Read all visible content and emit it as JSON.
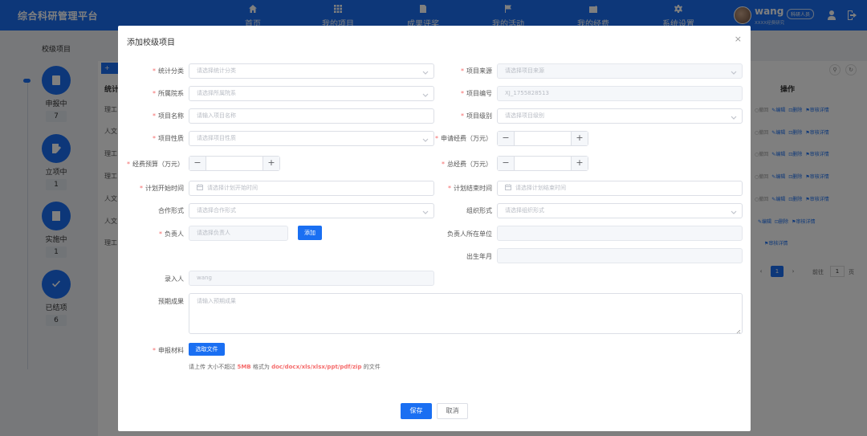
{
  "app": {
    "title": "综合科研管理平台"
  },
  "nav": [
    {
      "label": "首页",
      "icon": "home-icon"
    },
    {
      "label": "我的项目",
      "icon": "grid-icon"
    },
    {
      "label": "成果评奖",
      "icon": "document-icon"
    },
    {
      "label": "我的活动",
      "icon": "flag-icon"
    },
    {
      "label": "我的经费",
      "icon": "wallet-icon"
    },
    {
      "label": "系统设置",
      "icon": "gear-icon"
    }
  ],
  "user": {
    "name": "wang",
    "role": "科研人员",
    "org": "XXXX经费研究"
  },
  "sidebar": {
    "title": "校级项目",
    "statuses": [
      {
        "label": "申报中",
        "count": "7"
      },
      {
        "label": "立项中",
        "count": "1"
      },
      {
        "label": "实施中",
        "count": "1"
      },
      {
        "label": "已结项",
        "count": "6"
      }
    ]
  },
  "background": {
    "add_label": "+",
    "column_head": "统计",
    "op_head": "操作",
    "rows": [
      "理工",
      "人文",
      "理工",
      "理工",
      "人文",
      "人文",
      "理工"
    ],
    "row_ops": [
      {
        "a": "○撤回",
        "b": "✎编辑",
        "c": "⊡删除",
        "d": "⚑审核详情"
      },
      {
        "a": "○撤回",
        "b": "✎编辑",
        "c": "⊡删除",
        "d": "⚑审核详情"
      },
      {
        "a": "○撤回",
        "b": "✎编辑",
        "c": "⊡删除",
        "d": "⚑审核详情"
      },
      {
        "a": "○撤回",
        "b": "✎编辑",
        "c": "⊡删除",
        "d": "⚑审核详情"
      },
      {
        "a": "○撤回",
        "b": "✎编辑",
        "c": "⊡删除",
        "d": "⚑审核详情"
      },
      {
        "a": "",
        "b": "✎编辑",
        "c": "⊡删除",
        "d": "⚑审核详情"
      },
      {
        "a": "",
        "b": "",
        "c": "",
        "d": "⚑审核详情"
      }
    ],
    "pager": {
      "prev": "‹",
      "current": "1",
      "next": "›",
      "goto": "前往",
      "goto_value": "1",
      "goto_end": "页"
    }
  },
  "dialog": {
    "title": "添加校级项目",
    "close": "×",
    "fields": {
      "category": {
        "label": "统计分类",
        "placeholder": "请选择统计分类"
      },
      "source": {
        "label": "项目来源",
        "placeholder": "请选择项目来源"
      },
      "dept": {
        "label": "所属院系",
        "placeholder": "请选择所属院系"
      },
      "number": {
        "label": "项目编号",
        "value": "XJ_1755828513"
      },
      "name": {
        "label": "项目名称",
        "placeholder": "请输入项目名称"
      },
      "level": {
        "label": "项目级别",
        "placeholder": "请选择项目级别"
      },
      "nature": {
        "label": "项目性质",
        "placeholder": "请选择项目性质"
      },
      "applied_fund": {
        "label": "申请经费（万元）"
      },
      "budget": {
        "label": "经费预算（万元）"
      },
      "total_fund": {
        "label": "总经费（万元）"
      },
      "start": {
        "label": "计划开始时间",
        "placeholder": "请选择计划开始时间"
      },
      "end": {
        "label": "计划结束时间",
        "placeholder": "请选择计划结束时间"
      },
      "coop": {
        "label": "合作形式",
        "placeholder": "请选择合作形式"
      },
      "org_form": {
        "label": "组织形式",
        "placeholder": "请选择组织形式"
      },
      "leader": {
        "label": "负责人",
        "placeholder": "请选择负责人",
        "add_button": "添加"
      },
      "leader_unit": {
        "label": "负责人所在单位"
      },
      "birth": {
        "label": "出生年月"
      },
      "recorder": {
        "label": "录入人",
        "value": "wang"
      },
      "outcome": {
        "label": "预期成果",
        "placeholder": "请输入预期成果"
      },
      "material": {
        "label": "申报材料",
        "button": "选取文件"
      }
    },
    "hint": {
      "prefix": "请上传 大小不超过 ",
      "size": "5MB",
      "mid": " 格式为 ",
      "formats": "doc/docx/xls/xlsx/ppt/pdf/zip",
      "suffix": " 的文件"
    },
    "save": "保存",
    "cancel": "取消"
  }
}
